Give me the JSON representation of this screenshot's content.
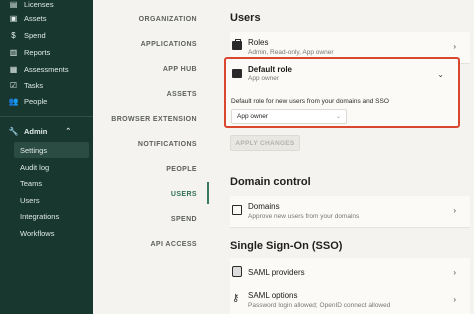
{
  "sidebar": {
    "items": [
      {
        "label": "Licenses",
        "icon": "license-icon"
      },
      {
        "label": "Assets",
        "icon": "assets-icon"
      },
      {
        "label": "Spend",
        "icon": "dollar-icon"
      },
      {
        "label": "Reports",
        "icon": "reports-icon"
      },
      {
        "label": "Assessments",
        "icon": "assessments-icon"
      },
      {
        "label": "Tasks",
        "icon": "tasks-icon"
      },
      {
        "label": "People",
        "icon": "people-icon"
      }
    ],
    "admin": {
      "label": "Admin",
      "icon": "wrench-icon"
    },
    "admin_items": [
      {
        "label": "Settings"
      },
      {
        "label": "Audit log"
      },
      {
        "label": "Teams"
      },
      {
        "label": "Users"
      },
      {
        "label": "Integrations"
      },
      {
        "label": "Workflows"
      }
    ]
  },
  "settings_nav": {
    "items": [
      "ORGANIZATION",
      "APPLICATIONS",
      "APP HUB",
      "ASSETS",
      "BROWSER EXTENSION",
      "NOTIFICATIONS",
      "PEOPLE",
      "USERS",
      "SPEND",
      "API ACCESS"
    ],
    "active": "USERS"
  },
  "users_section": {
    "title": "Users",
    "roles": {
      "title": "Roles",
      "subtitle": "Admin, Read-only, App owner"
    },
    "default_role": {
      "title": "Default role",
      "subtitle": "App owner",
      "description": "Default role for new users from your domains and SSO",
      "selected": "App owner"
    },
    "apply_label": "APPLY CHANGES"
  },
  "domain_section": {
    "title": "Domain control",
    "domains": {
      "title": "Domains",
      "subtitle": "Approve new users from your domains"
    }
  },
  "sso_section": {
    "title": "Single Sign-On (SSO)",
    "saml_providers": {
      "title": "SAML providers"
    },
    "saml_options": {
      "title": "SAML options",
      "subtitle": "Password login allowed; OpenID connect allowed"
    }
  },
  "colors": {
    "sidebar_bg": "#18382f",
    "accent": "#2f6e5a",
    "highlight_border": "#d9482e"
  }
}
